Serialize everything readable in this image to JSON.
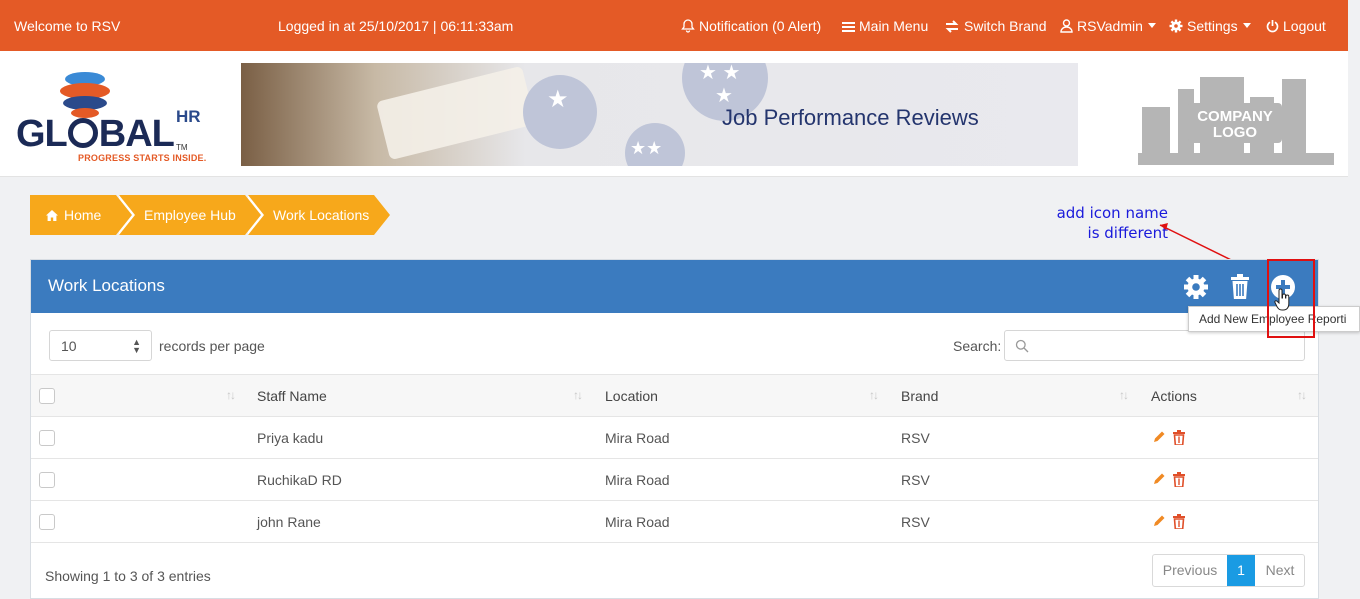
{
  "topbar": {
    "welcome": "Welcome to RSV",
    "login_info": "Logged in at 25/10/2017 | 06:11:33am",
    "notification": "Notification (0 Alert)",
    "main_menu": "Main Menu",
    "switch_brand": "Switch Brand",
    "user": "RSVadmin",
    "settings": "Settings",
    "logout": "Logout"
  },
  "header": {
    "logo_word": "GL",
    "logo_word_2": "BAL",
    "logo_hr": "HR",
    "logo_tm": "TM",
    "logo_tagline": "PROGRESS STARTS INSIDE.",
    "banner_title": "Job Performance Reviews",
    "company_logo_line1": "COMPANY",
    "company_logo_line2": "LOGO"
  },
  "breadcrumb": {
    "home": "Home",
    "items": [
      "Employee Hub",
      "Work Locations"
    ]
  },
  "annotation": {
    "line1": "add icon name",
    "line2": "is different"
  },
  "panel": {
    "title": "Work Locations",
    "records_per_page_value": "10",
    "records_per_page_label": "records per page",
    "search_label": "Search:",
    "search_value": "",
    "tooltip": "Add New Employee Reporti"
  },
  "table": {
    "headers": [
      "Staff Name",
      "Location",
      "Brand",
      "Actions"
    ],
    "rows": [
      {
        "name": "Priya kadu",
        "location": "Mira Road",
        "brand": "RSV"
      },
      {
        "name": "RuchikaD RD",
        "location": "Mira Road",
        "brand": "RSV"
      },
      {
        "name": "john Rane",
        "location": "Mira Road",
        "brand": "RSV"
      }
    ]
  },
  "footer": {
    "info": "Showing 1 to 3 of 3 entries",
    "previous": "Previous",
    "page": "1",
    "next": "Next"
  },
  "colors": {
    "topbar": "#e45a26",
    "panel_header": "#3b7bbf",
    "breadcrumb": "#f7a81b",
    "page_active": "#1a9be3",
    "action_edit": "#f08a24",
    "action_delete": "#e0502a",
    "annotation": "#1a1adb",
    "highlight": "#e01010"
  },
  "icons": [
    "bell-icon",
    "menu-icon",
    "switch-icon",
    "user-icon",
    "gear-icon",
    "power-icon",
    "home-icon",
    "settings-icon",
    "trash-icon",
    "add-icon",
    "search-icon",
    "pencil-icon",
    "delete-icon",
    "sort-icon"
  ]
}
